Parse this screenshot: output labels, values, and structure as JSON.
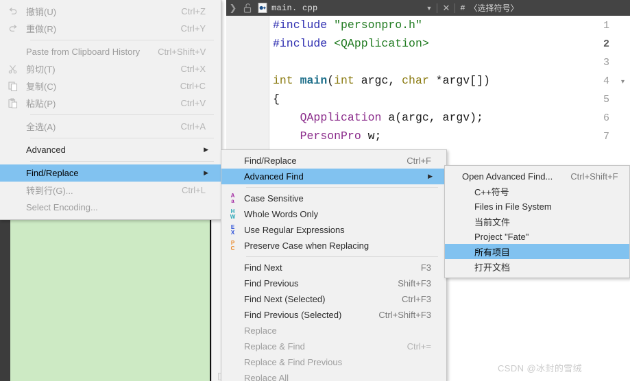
{
  "editor": {
    "tab": {
      "chevron_icon": "chevron-right-icon",
      "lock_icon": "unlocked-padlock-icon",
      "file_icon": "cpp-file-icon",
      "filename": "main. cpp",
      "caret_icon": "chevron-down-icon",
      "close_icon": "close-icon",
      "hash_icon": "#",
      "symbol_selector": "〈选择符号〉"
    },
    "line_numbers": [
      "1",
      "2",
      "3",
      "4",
      "5",
      "6",
      "7"
    ],
    "current_line": "2",
    "fold_marker_line": "4",
    "fold_icon": "chevron-down-icon",
    "lines": [
      [
        {
          "t": "#include ",
          "c": "c-pre"
        },
        {
          "t": "\"personpro.h\"",
          "c": "c-str"
        }
      ],
      [
        {
          "t": "#include ",
          "c": "c-pre"
        },
        {
          "t": "<QApplication>",
          "c": "c-str"
        }
      ],
      [],
      [
        {
          "t": "int ",
          "c": "c-kw"
        },
        {
          "t": "main",
          "c": "c-fn"
        },
        {
          "t": "(",
          "c": "c-pln"
        },
        {
          "t": "int ",
          "c": "c-kw"
        },
        {
          "t": "argc, ",
          "c": "c-pln"
        },
        {
          "t": "char ",
          "c": "c-kw"
        },
        {
          "t": "*argv[])",
          "c": "c-pln"
        }
      ],
      [
        {
          "t": "{",
          "c": "c-pln"
        }
      ],
      [
        {
          "t": "    ",
          "c": "c-pln"
        },
        {
          "t": "QApplication",
          "c": "c-type"
        },
        {
          "t": " a(argc, argv);",
          "c": "c-pln"
        }
      ],
      [
        {
          "t": "    ",
          "c": "c-pln"
        },
        {
          "t": "PersonPro",
          "c": "c-type"
        },
        {
          "t": " w;",
          "c": "c-pln"
        }
      ]
    ]
  },
  "menu_edit": {
    "items": [
      {
        "icon": "undo-icon",
        "label": "撤销(U)",
        "accel": "Ctrl+Z",
        "disabled": true
      },
      {
        "icon": "redo-icon",
        "label": "重做(R)",
        "accel": "Ctrl+Y",
        "disabled": true
      },
      {
        "separator": true
      },
      {
        "icon": null,
        "label": "Paste from Clipboard History",
        "accel": "Ctrl+Shift+V",
        "disabled": true
      },
      {
        "icon": "scissors-icon",
        "label": "剪切(T)",
        "accel": "Ctrl+X",
        "disabled": true
      },
      {
        "icon": "copy-icon",
        "label": "复制(C)",
        "accel": "Ctrl+C",
        "disabled": true
      },
      {
        "icon": "paste-icon",
        "label": "粘贴(P)",
        "accel": "Ctrl+V",
        "disabled": true
      },
      {
        "separator": true
      },
      {
        "icon": null,
        "label": "全选(A)",
        "accel": "Ctrl+A",
        "disabled": true
      },
      {
        "separator": true
      },
      {
        "icon": null,
        "label": "Advanced",
        "submenu": true
      },
      {
        "separator": true
      },
      {
        "icon": null,
        "label": "Find/Replace",
        "submenu": true,
        "selected": true
      },
      {
        "icon": null,
        "label": "转到行(G)...",
        "accel": "Ctrl+L",
        "disabled": true
      },
      {
        "icon": null,
        "label": "Select Encoding...",
        "disabled": true
      }
    ]
  },
  "menu_find": {
    "items": [
      {
        "icon": null,
        "label": "Find/Replace",
        "accel": "Ctrl+F"
      },
      {
        "icon": null,
        "label": "Advanced Find",
        "submenu": true,
        "selected": true
      },
      {
        "separator": true
      },
      {
        "icon": "case-sensitive-icon",
        "icon_text_top": "A",
        "icon_text_bottom": "a",
        "icon_color": "#a32ba3",
        "label": "Case Sensitive"
      },
      {
        "icon": "whole-words-icon",
        "icon_text_top": "H",
        "icon_text_bottom": "W",
        "icon_color": "#2aa8b8",
        "label": "Whole Words Only"
      },
      {
        "icon": "regex-icon",
        "icon_text_top": "E",
        "icon_text_bottom": "X",
        "icon_color": "#2a4fd8",
        "label": "Use Regular Expressions"
      },
      {
        "icon": "preserve-case-icon",
        "icon_text_top": "P",
        "icon_text_bottom": "C",
        "icon_color": "#e8892a",
        "label": "Preserve Case when Replacing"
      },
      {
        "separator": true
      },
      {
        "icon": null,
        "label": "Find Next",
        "accel": "F3"
      },
      {
        "icon": null,
        "label": "Find Previous",
        "accel": "Shift+F3"
      },
      {
        "icon": null,
        "label": "Find Next (Selected)",
        "accel": "Ctrl+F3"
      },
      {
        "icon": null,
        "label": "Find Previous (Selected)",
        "accel": "Ctrl+Shift+F3"
      },
      {
        "icon": null,
        "label": "Replace",
        "disabled": true
      },
      {
        "icon": null,
        "label": "Replace & Find",
        "accel": "Ctrl+=",
        "disabled": true
      },
      {
        "icon": null,
        "label": "Replace & Find Previous",
        "disabled": true
      },
      {
        "icon": null,
        "label": "Replace All",
        "disabled": true
      }
    ]
  },
  "menu_advanced_find": {
    "items": [
      {
        "label": "Open Advanced Find...",
        "accel": "Ctrl+Shift+F"
      },
      {
        "label": "C++符号",
        "indent": true
      },
      {
        "label": "Files in File System",
        "indent": true
      },
      {
        "label": "当前文件",
        "indent": true
      },
      {
        "label": "Project \"Fate\"",
        "indent": true
      },
      {
        "label": "所有项目",
        "indent": true,
        "selected": true
      },
      {
        "label": "打开文档",
        "indent": true
      }
    ]
  },
  "watermark": "CSDN @冰封的雪绒",
  "colors": {
    "menu_bg": "#f1f1f1",
    "menu_border": "#c6c6c6",
    "highlight": "#81c2f0",
    "tabbar_bg": "#444444",
    "green_panel": "#cdeac4",
    "disabled_text": "#9d9d9d"
  }
}
